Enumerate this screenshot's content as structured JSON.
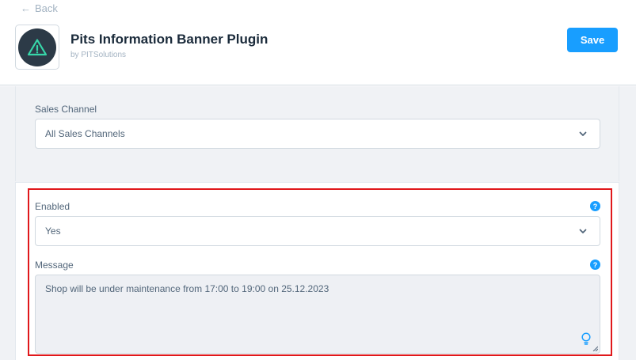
{
  "header": {
    "back_label": "Back",
    "title": "Pits Information Banner Plugin",
    "subtitle": "by PITSolutions",
    "save_label": "Save"
  },
  "sales_channel": {
    "label": "Sales Channel",
    "value": "All Sales Channels"
  },
  "enabled": {
    "label": "Enabled",
    "value": "Yes"
  },
  "message": {
    "label": "Message",
    "value": "Shop will be under maintenance from 17:00 to 19:00 on 25.12.2023"
  },
  "colors": {
    "accent": "#189eff",
    "highlight": "#e0181b",
    "icon_bg": "#2c3a47",
    "icon_fg": "#37d6a9"
  }
}
